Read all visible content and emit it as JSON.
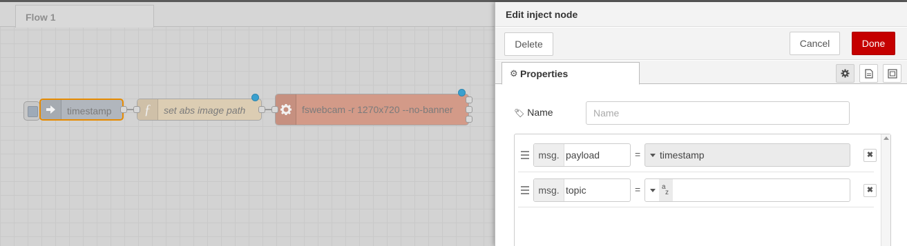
{
  "workspace": {
    "tab_label": "Flow 1",
    "nodes": {
      "inject_label": "timestamp",
      "function_label": "set abs image path",
      "exec_label": "fswebcam -r 1270x720 --no-banner"
    },
    "colors": {
      "inject": "#b1b6bd",
      "function": "#dccdb3",
      "exec": "#d39a88",
      "changed_dot": "#3aa0cf"
    }
  },
  "tray": {
    "title": "Edit inject node",
    "buttons": {
      "delete": "Delete",
      "cancel": "Cancel",
      "done": "Done"
    },
    "tab_properties": "Properties",
    "tab_icons": [
      "settings-icon",
      "description-icon",
      "appearance-icon"
    ],
    "name": {
      "label": "Name",
      "placeholder": "Name",
      "value": ""
    },
    "props": [
      {
        "prefix": "msg.",
        "property": "payload",
        "type": "timestamp",
        "type_icon": "caret-down-icon",
        "value": "timestamp"
      },
      {
        "prefix": "msg.",
        "property": "topic",
        "type": "string",
        "type_icon": "az-string-icon",
        "value": ""
      }
    ],
    "equals": "=",
    "colors": {
      "done": "#c50000"
    }
  }
}
